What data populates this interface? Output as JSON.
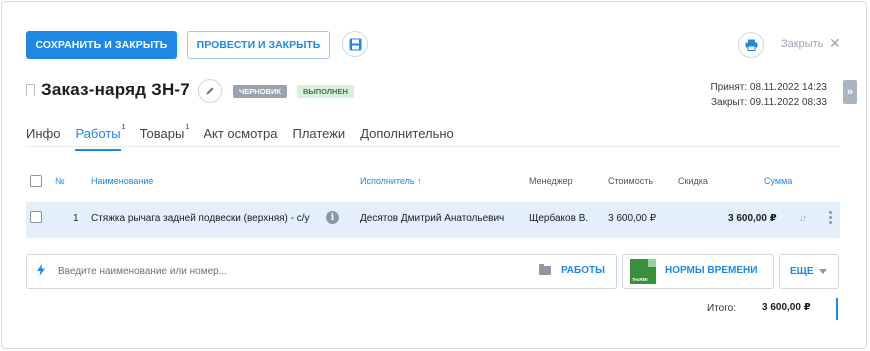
{
  "toolbar": {
    "save_close_label": "СОХРАНИТЬ И ЗАКРЫТЬ",
    "post_close_label": "ПРОВЕСТИ И ЗАКРЫТЬ",
    "close_label": "Закрыть"
  },
  "header": {
    "title": "Заказ-наряд ЗН-7",
    "status_draft": "ЧЕРНОВИК",
    "status_done": "ВЫПОЛНЕН",
    "accepted": "Принят: 08.11.2022 14:23",
    "closed": "Закрыт: 09.11.2022 08:33"
  },
  "tabs": [
    {
      "label": "Инфо",
      "count": ""
    },
    {
      "label": "Работы",
      "count": "1"
    },
    {
      "label": "Товары",
      "count": "1"
    },
    {
      "label": "Акт осмотра",
      "count": ""
    },
    {
      "label": "Платежи",
      "count": ""
    },
    {
      "label": "Дополнительно",
      "count": ""
    }
  ],
  "table": {
    "headers": {
      "num": "№",
      "name": "Наименование",
      "executor": "Исполнитель ↑",
      "manager": "Менеджер",
      "cost": "Стоимость",
      "discount": "Скидка",
      "sum": "Сумма"
    },
    "rows": [
      {
        "num": "1",
        "name": "Стяжка рычага задней подвески (верхняя) - с/у",
        "executor": "Десятов Дмитрий Анатольевич",
        "manager": "Щербаков В.",
        "cost": "3 600,00 ₽",
        "discount": "",
        "sum": "3 600,00 ₽"
      }
    ]
  },
  "search": {
    "placeholder": "Введите наименование или номер...",
    "works_label": "РАБОТЫ"
  },
  "actions": {
    "norms_label": "НОРМЫ ВРЕМЕНИ",
    "tecrmi_logo": "TecRMI",
    "more_label": "ЕЩЕ"
  },
  "totals": {
    "label": "Итого:",
    "value": "3 600,00 ₽"
  },
  "colors": {
    "accent": "#1e88e5",
    "row_highlight": "#e3effb",
    "done_badge": "#d8f0dc",
    "draft_badge": "#9aa3ad"
  }
}
